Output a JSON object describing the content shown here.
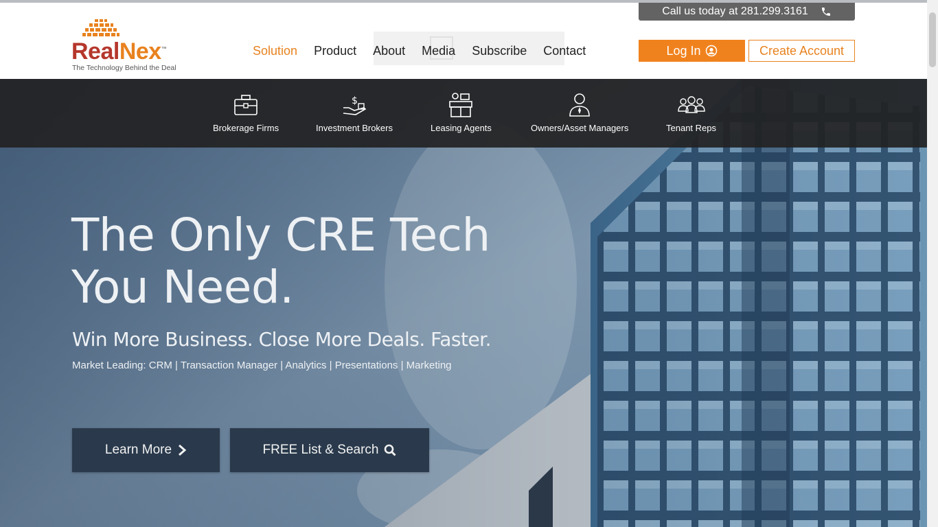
{
  "header": {
    "call_text": "Call us today at 281.299.3161",
    "logo": {
      "name_part1": "Real",
      "name_part2": "Nex",
      "trademark": "™",
      "tagline": "The Technology Behind the Deal"
    },
    "nav": [
      "Solution",
      "Product",
      "About",
      "Media",
      "Subscribe",
      "Contact"
    ],
    "active_nav": "Solution",
    "login_label": "Log In",
    "create_account_label": "Create Account"
  },
  "roles": [
    {
      "label": "Brokerage Firms",
      "icon": "briefcase-icon"
    },
    {
      "label": "Investment Brokers",
      "icon": "money-hand-icon"
    },
    {
      "label": "Leasing Agents",
      "icon": "agent-desk-icon"
    },
    {
      "label": "Owners/Asset Managers",
      "icon": "person-tie-icon"
    },
    {
      "label": "Tenant Reps",
      "icon": "group-icon"
    }
  ],
  "hero": {
    "headline_line1": "The Only CRE Tech",
    "headline_line2": "You Need.",
    "subheadline": "Win More Business. Close More Deals. Faster.",
    "features": "Market Leading: CRM | Transaction Manager | Analytics | Presentations | Marketing",
    "learn_more_label": "Learn More",
    "free_search_label": "FREE List & Search"
  },
  "colors": {
    "brand_orange": "#f0821e",
    "brand_red": "#b5372c",
    "roles_bar": "#232325",
    "hero_button": "#2a3a4c"
  }
}
